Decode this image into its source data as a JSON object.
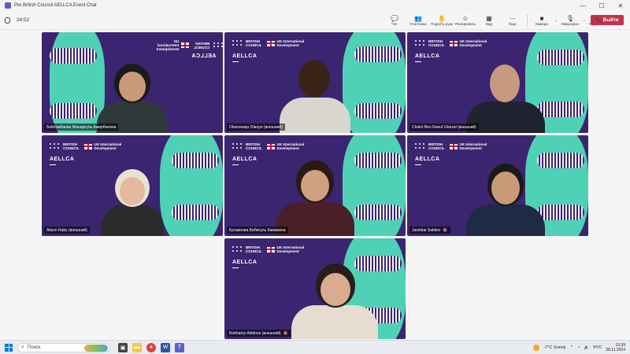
{
  "window": {
    "title": "Pre British Council AELLCA Event Chat",
    "controls": {
      "minimize": "—",
      "maximize": "☐",
      "close": "✕"
    }
  },
  "meeting": {
    "timer": "24:52",
    "tools": [
      {
        "icon": "chat-icon",
        "glyph": "💬",
        "label": "Чат"
      },
      {
        "icon": "participants-icon",
        "glyph": "👥",
        "label": "Участники"
      },
      {
        "icon": "raise-hand-icon",
        "glyph": "✋",
        "label": "Поднять руку"
      },
      {
        "icon": "reactions-icon",
        "glyph": "☺",
        "label": "Реагировать"
      },
      {
        "icon": "view-icon",
        "glyph": "▦",
        "label": "Вид"
      },
      {
        "icon": "more-icon",
        "glyph": "⋯",
        "label": "Еще"
      },
      {
        "icon": "camera-icon",
        "glyph": "■",
        "label": "Камера"
      },
      {
        "icon": "mic-icon",
        "glyph": "🎙",
        "label": "Микрофон"
      },
      {
        "icon": "share-icon",
        "glyph": "⬆",
        "label": "Поделиться"
      }
    ],
    "leave_label": "📞 Выйти"
  },
  "branding": {
    "org_line1": "BRITISH",
    "org_line2": "COUNCIL",
    "partner_line1": "UK International",
    "partner_line2": "Development",
    "programme": "AELLCA",
    "colors": {
      "tile_bg": "#3b2570",
      "teal": "#4fd1b5",
      "leave": "#c4314b"
    }
  },
  "participants": [
    {
      "name": "Бейсембаева Жанаргуль Амирбеевна",
      "mirrored": true
    },
    {
      "name": "Olanrewaju Olaoye (внешний)",
      "active": true
    },
    {
      "name": "Chokri Ben Raouf Ghezal (внешний)"
    },
    {
      "name": "Alison Raby (внешний)"
    },
    {
      "name": "Кусаинова Бибигуль Камиевна"
    },
    {
      "name": "Jasinbai Sabitov",
      "muted": true
    },
    {
      "name": "Rokhatoy Abidova (внешний)",
      "muted": true
    }
  ],
  "taskbar": {
    "search_placeholder": "Поиск",
    "weather": "-7°C  Sunny",
    "language": "РУС",
    "time": "13:39",
    "date": "28.11.2024"
  }
}
